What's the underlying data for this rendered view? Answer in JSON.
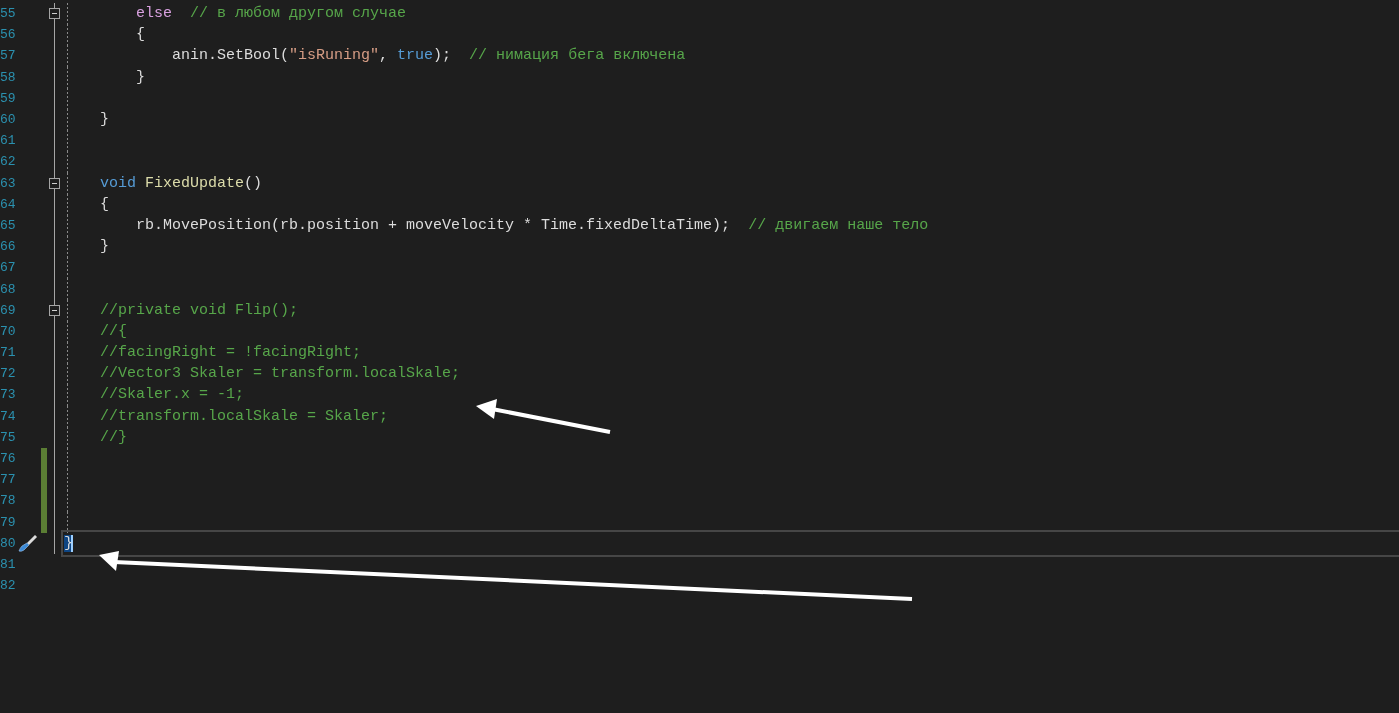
{
  "editor": {
    "lines": [
      {
        "number": "55",
        "fold_marker": true,
        "changed": false,
        "current": false,
        "tokens": [
          {
            "text": "        else",
            "kind": "control"
          },
          {
            "text": "  // в любом другом случае",
            "kind": "comment"
          }
        ]
      },
      {
        "number": "56",
        "fold_marker": false,
        "changed": false,
        "current": false,
        "tokens": [
          {
            "text": "        {",
            "kind": "plain"
          }
        ]
      },
      {
        "number": "57",
        "fold_marker": false,
        "changed": false,
        "current": false,
        "tokens": [
          {
            "text": "            anin.SetBool(",
            "kind": "plain"
          },
          {
            "text": "\"isRuning\"",
            "kind": "string"
          },
          {
            "text": ", ",
            "kind": "plain"
          },
          {
            "text": "true",
            "kind": "keyword"
          },
          {
            "text": ");  ",
            "kind": "plain"
          },
          {
            "text": "// нимация бега включена",
            "kind": "comment"
          }
        ]
      },
      {
        "number": "58",
        "fold_marker": false,
        "changed": false,
        "current": false,
        "tokens": [
          {
            "text": "        }",
            "kind": "plain"
          }
        ]
      },
      {
        "number": "59",
        "fold_marker": false,
        "changed": false,
        "current": false
      },
      {
        "number": "60",
        "fold_marker": false,
        "changed": false,
        "current": false,
        "tokens": [
          {
            "text": "    }",
            "kind": "plain"
          }
        ]
      },
      {
        "number": "61",
        "fold_marker": false,
        "changed": false,
        "current": false
      },
      {
        "number": "62",
        "fold_marker": false,
        "changed": false,
        "current": false
      },
      {
        "number": "63",
        "fold_marker": true,
        "changed": false,
        "current": false,
        "tokens": [
          {
            "text": "    void",
            "kind": "keyword"
          },
          {
            "text": " FixedUpdate",
            "kind": "method"
          },
          {
            "text": "()",
            "kind": "plain"
          }
        ]
      },
      {
        "number": "64",
        "fold_marker": false,
        "changed": false,
        "current": false,
        "tokens": [
          {
            "text": "    {",
            "kind": "plain"
          }
        ]
      },
      {
        "number": "65",
        "fold_marker": false,
        "changed": false,
        "current": false,
        "tokens": [
          {
            "text": "        rb.MovePosition(rb.position + moveVelocity * Time.fixedDeltaTime);  ",
            "kind": "plain"
          },
          {
            "text": "// двигаем наше тело",
            "kind": "comment"
          }
        ]
      },
      {
        "number": "66",
        "fold_marker": false,
        "changed": false,
        "current": false,
        "tokens": [
          {
            "text": "    }",
            "kind": "plain"
          }
        ]
      },
      {
        "number": "67",
        "fold_marker": false,
        "changed": false,
        "current": false
      },
      {
        "number": "68",
        "fold_marker": false,
        "changed": false,
        "current": false
      },
      {
        "number": "69",
        "fold_marker": true,
        "changed": false,
        "current": false,
        "tokens": [
          {
            "text": "    //private void Flip();",
            "kind": "comment"
          }
        ]
      },
      {
        "number": "70",
        "fold_marker": false,
        "changed": false,
        "current": false,
        "tokens": [
          {
            "text": "    //{",
            "kind": "comment"
          }
        ]
      },
      {
        "number": "71",
        "fold_marker": false,
        "changed": false,
        "current": false,
        "tokens": [
          {
            "text": "    //facingRight = !facingRight;",
            "kind": "comment"
          }
        ]
      },
      {
        "number": "72",
        "fold_marker": false,
        "changed": false,
        "current": false,
        "tokens": [
          {
            "text": "    //Vector3 Skaler = transform.localSkale;",
            "kind": "comment"
          }
        ]
      },
      {
        "number": "73",
        "fold_marker": false,
        "changed": false,
        "current": false,
        "tokens": [
          {
            "text": "    //Skaler.x = -1;",
            "kind": "comment"
          }
        ]
      },
      {
        "number": "74",
        "fold_marker": false,
        "changed": false,
        "current": false,
        "tokens": [
          {
            "text": "    //transform.localSkale = Skaler;",
            "kind": "comment"
          }
        ]
      },
      {
        "number": "75",
        "fold_marker": false,
        "changed": false,
        "current": false,
        "tokens": [
          {
            "text": "    //}",
            "kind": "comment"
          }
        ]
      },
      {
        "number": "76",
        "fold_marker": false,
        "changed": true,
        "current": false
      },
      {
        "number": "77",
        "fold_marker": false,
        "changed": true,
        "current": false
      },
      {
        "number": "78",
        "fold_marker": false,
        "changed": true,
        "current": false
      },
      {
        "number": "79",
        "fold_marker": false,
        "changed": true,
        "current": false
      },
      {
        "number": "80",
        "fold_marker": false,
        "changed": false,
        "current": true,
        "tokens": [
          {
            "text": "}",
            "kind": "brace-match"
          }
        ]
      },
      {
        "number": "81",
        "fold_marker": false,
        "changed": false,
        "current": false
      },
      {
        "number": "82",
        "fold_marker": false,
        "changed": false,
        "current": false
      }
    ]
  }
}
